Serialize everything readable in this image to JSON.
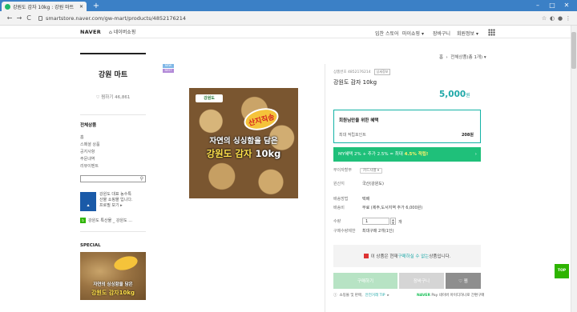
{
  "browser": {
    "tab_title": "강원도 감자 10kg : 강원 마트",
    "new_tab": "+",
    "url": "smartstore.naver.com/gw-mart/products/4852176214",
    "back": "←",
    "forward": "→",
    "reload": "C",
    "minimize": "–",
    "maximize": "□",
    "close": "✕"
  },
  "site_header": {
    "logo": "NAVER",
    "home_link": "네이버쇼핑",
    "nav": [
      "입찬 스토어",
      "마이쇼핑 ▾",
      "장바구니",
      "회원정보 ▾"
    ]
  },
  "sidebar": {
    "store_name": "강원 마트",
    "favorites": "찜하기 46,861",
    "category_title": "전체상품",
    "categories": [
      "홈",
      "스페셜 상품",
      "공지사항",
      "주문내역",
      "리뷰이벤트"
    ],
    "partner_line1": "강원도 대표 농수특",
    "partner_line2": "산물 쇼핑몰 입니다.",
    "partner_link": "프로필 보기 ▸",
    "band": "강원도 특산물 _ 강원도 ...",
    "special_title": "SPECIAL",
    "special_line1": "자연의 싱싱함을 담은",
    "special_line2": "강원도 감자10kg"
  },
  "product": {
    "badges": [
      "NEW",
      "BEST"
    ],
    "image_brand": "강원도",
    "image_burst": "산지직송",
    "image_line1": "자연의 싱싱함을 담은",
    "image_line2a": "강원도 감자",
    "image_line2b": "10kg"
  },
  "panel": {
    "breadcrumb_home": "홈",
    "breadcrumb_cat": "전체상품(총 1개) ▾",
    "meta_no": "상품번호 4852176214",
    "meta_tag": "상세정보",
    "title": "강원도 감자 10kg",
    "price": "5,000",
    "price_unit": "원",
    "benefit_title": "회원님만을 위한 혜택",
    "benefit_label": "최대 적립포인트",
    "benefit_value": "208원",
    "mybar_text": "MY혜택 2% + 추가 2.5% = 최대 ",
    "mybar_highlight": "4.5% 적립!",
    "rows": [
      {
        "label": "무이자할부",
        "value": "카드사별 ▾"
      },
      {
        "label": "원산지",
        "value": "국산(강원도)"
      },
      {
        "label": "배송방법",
        "value": "택배"
      },
      {
        "label": "배송비",
        "value": "무료 (제주,도서지역 추가 6,000원)"
      },
      {
        "label": "수량",
        "value": "개"
      },
      {
        "label": "구매수량제한",
        "value": "최대구매 2개(1인)"
      }
    ],
    "qty_value": "1",
    "notice_pre": "이 상품은 현재 ",
    "notice_hl": "구매하실 수 없는",
    "notice_post": " 상품입니다.",
    "buy": "구매하기",
    "cart": "장바구니",
    "wish": "♡ 찜",
    "footer_pre": "쇼핑몰 및 판매, ",
    "footer_hl": "안전거래 TIP",
    "footer_post": " ▸",
    "npay_prefix": "NAVER",
    "npay_text": " Pay 네이버 아이디하나로 간편구매"
  },
  "top_button": "TOP"
}
